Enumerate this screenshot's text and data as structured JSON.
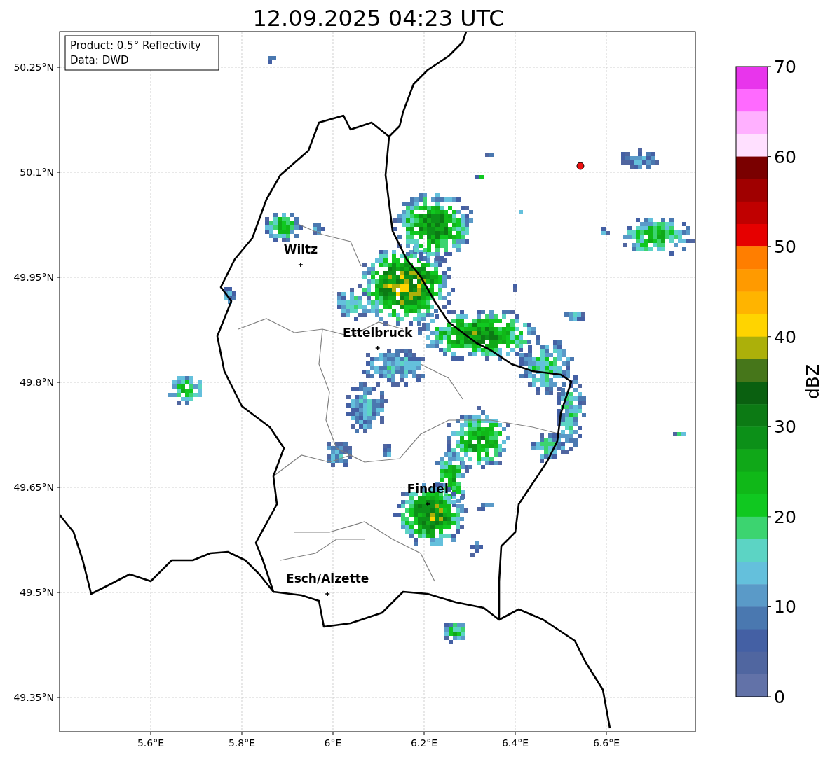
{
  "title": "12.09.2025 04:23 UTC",
  "info_box": {
    "lines": [
      "Product: 0.5° Reflectivity",
      "Data: DWD"
    ]
  },
  "map": {
    "lon_ticks": [
      "5.6°E",
      "5.8°E",
      "6°E",
      "6.2°E",
      "6.4°E",
      "6.6°E"
    ],
    "lat_ticks": [
      "50.25°N",
      "50.1°N",
      "49.95°N",
      "49.8°N",
      "49.65°N",
      "49.5°N",
      "49.35°N"
    ],
    "cities": [
      "Wiltz",
      "Ettelbruck",
      "Findel",
      "Esch/Alzette"
    ]
  },
  "colorbar": {
    "label": "dBZ",
    "ticks": [
      "70",
      "60",
      "50",
      "40",
      "30",
      "20",
      "10",
      "0"
    ],
    "bins": [
      {
        "color": "#e835ec"
      },
      {
        "color": "#ff6aff"
      },
      {
        "color": "#ffb0ff"
      },
      {
        "color": "#ffe0ff"
      },
      {
        "color": "#7a0000"
      },
      {
        "color": "#a00000"
      },
      {
        "color": "#c00000"
      },
      {
        "color": "#e60000"
      },
      {
        "color": "#ff7e00"
      },
      {
        "color": "#ff9a00"
      },
      {
        "color": "#ffb400"
      },
      {
        "color": "#ffd400"
      },
      {
        "color": "#acb00a"
      },
      {
        "color": "#46761a"
      },
      {
        "color": "#0a6010"
      },
      {
        "color": "#0c7a14"
      },
      {
        "color": "#0c9018"
      },
      {
        "color": "#10a818"
      },
      {
        "color": "#10b818"
      },
      {
        "color": "#10c820"
      },
      {
        "color": "#3cd470"
      },
      {
        "color": "#5cd4c4"
      },
      {
        "color": "#64c0dc"
      },
      {
        "color": "#5a9ac8"
      },
      {
        "color": "#4a78b0"
      },
      {
        "color": "#4460a4"
      },
      {
        "color": "#5066a0"
      },
      {
        "color": "#6272a8"
      }
    ]
  }
}
